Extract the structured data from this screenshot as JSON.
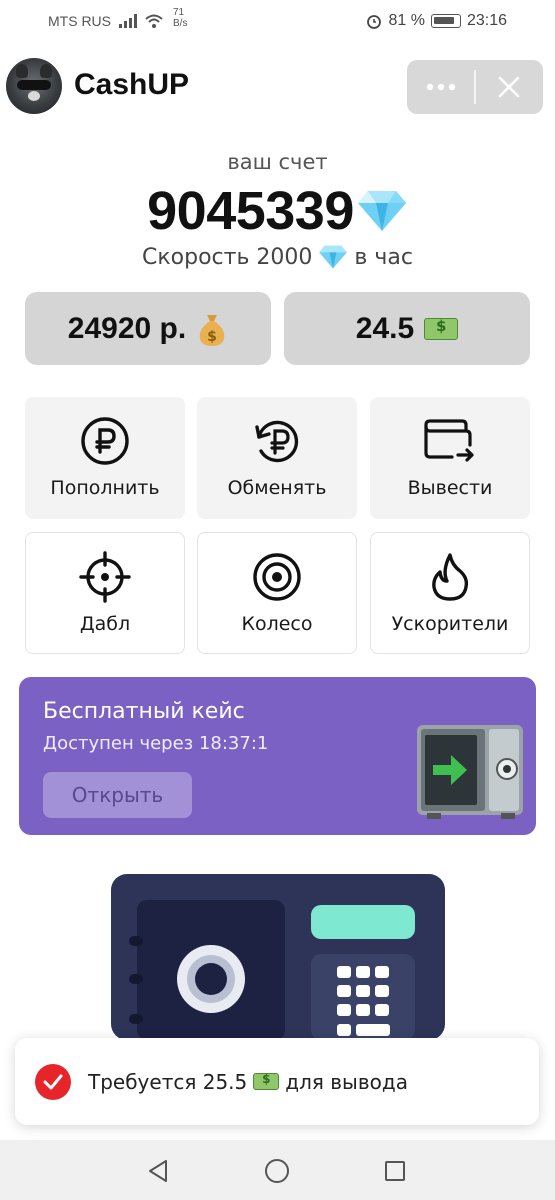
{
  "status_bar": {
    "carrier": "MTS RUS",
    "net_speed_value": "71",
    "net_speed_unit": "B/s",
    "battery": "81 %",
    "time": "23:16"
  },
  "header": {
    "title": "CashUP"
  },
  "account": {
    "label": "ваш счет",
    "balance": "9045339",
    "speed_prefix": "Скорость 2000",
    "speed_suffix": "в час"
  },
  "stats": {
    "rub": "24920 р.",
    "usd": "24.5"
  },
  "actions": [
    {
      "label": "Пополнить",
      "icon": "ruble-circle-icon"
    },
    {
      "label": "Обменять",
      "icon": "ruble-exchange-icon"
    },
    {
      "label": "Вывести",
      "icon": "wallet-withdraw-icon"
    },
    {
      "label": "Дабл",
      "icon": "crosshair-icon"
    },
    {
      "label": "Колесо",
      "icon": "target-wheel-icon"
    },
    {
      "label": "Ускорители",
      "icon": "flame-icon"
    }
  ],
  "free_case": {
    "title": "Бесплатный кейс",
    "timer": "Доступен через 18:37:1",
    "button": "Открыть",
    "icon": "safe-icon"
  },
  "toast": {
    "text_before": "Требуется 25.5",
    "text_after": "для вывода",
    "icon": "check-circle-icon"
  },
  "colors": {
    "case_banner": "#7b61c4",
    "stat_card": "#d5d5d5",
    "toast_icon": "#e8242b"
  }
}
